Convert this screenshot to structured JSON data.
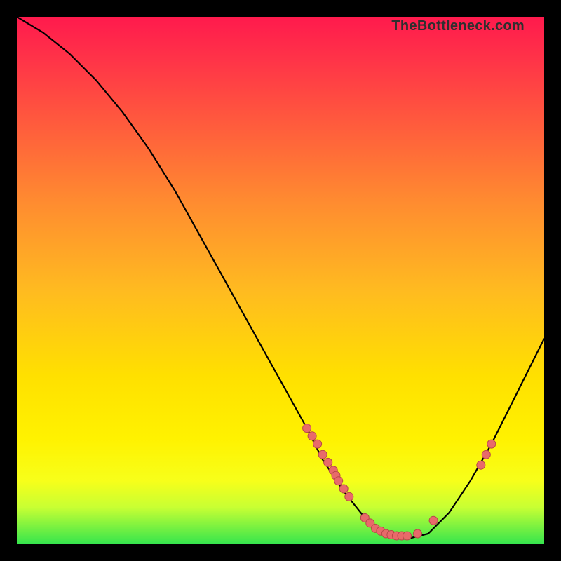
{
  "watermark": "TheBottleneck.com",
  "chart_data": {
    "type": "line",
    "title": "",
    "xlabel": "",
    "ylabel": "",
    "xlim": [
      0,
      100
    ],
    "ylim": [
      0,
      100
    ],
    "series": [
      {
        "name": "curve",
        "x": [
          0,
          5,
          10,
          15,
          20,
          25,
          30,
          35,
          40,
          45,
          50,
          55,
          58,
          62,
          66,
          70,
          74,
          78,
          82,
          86,
          90,
          94,
          98,
          100
        ],
        "y": [
          100,
          97,
          93,
          88,
          82,
          75,
          67,
          58,
          49,
          40,
          31,
          22,
          16,
          10,
          5,
          2,
          1,
          2,
          6,
          12,
          19,
          27,
          35,
          39
        ]
      }
    ],
    "scatter": {
      "name": "dots",
      "x": [
        55,
        56,
        57,
        58,
        59,
        60,
        60.5,
        61,
        62,
        63,
        66,
        67,
        68,
        69,
        70,
        71,
        72,
        73,
        74,
        76,
        79,
        88,
        89,
        90
      ],
      "y": [
        22,
        20.5,
        19,
        17,
        15.5,
        14,
        13,
        12,
        10.5,
        9,
        5,
        4,
        3,
        2.5,
        2,
        1.8,
        1.6,
        1.6,
        1.6,
        2,
        4.5,
        15,
        17,
        19
      ]
    },
    "colors": {
      "curve": "#000000",
      "dot_fill": "#e86a6a",
      "dot_stroke": "#b84848",
      "gradient_top": "#ff1a4d",
      "gradient_bottom": "#35e54d"
    }
  }
}
